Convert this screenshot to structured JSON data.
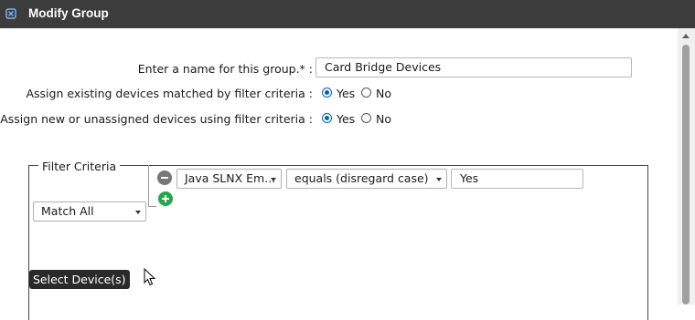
{
  "window": {
    "title": "Modify Group",
    "icon": "group-settings-icon"
  },
  "form": {
    "name_label": "Enter a name for this group.* :",
    "name_value": "Card Bridge Devices",
    "existing_label": "Assign existing devices matched by filter criteria :",
    "existing_yes": "Yes",
    "existing_no": "No",
    "existing_selected": "Yes",
    "new_label": "Assign new or unassigned devices using filter criteria :",
    "new_yes": "Yes",
    "new_no": "No",
    "new_selected": "Yes"
  },
  "filter": {
    "legend": "Filter Criteria",
    "criteria": [
      {
        "field": "Java SLNX Em...",
        "operator": "equals (disregard case)",
        "value": "Yes"
      }
    ],
    "match": "Match All"
  },
  "tooltip": "Select Device(s)",
  "colors": {
    "titlebar": "#3c3c3c",
    "radio_accent": "#0063b1",
    "add": "#22a84a",
    "remove": "#777777"
  }
}
